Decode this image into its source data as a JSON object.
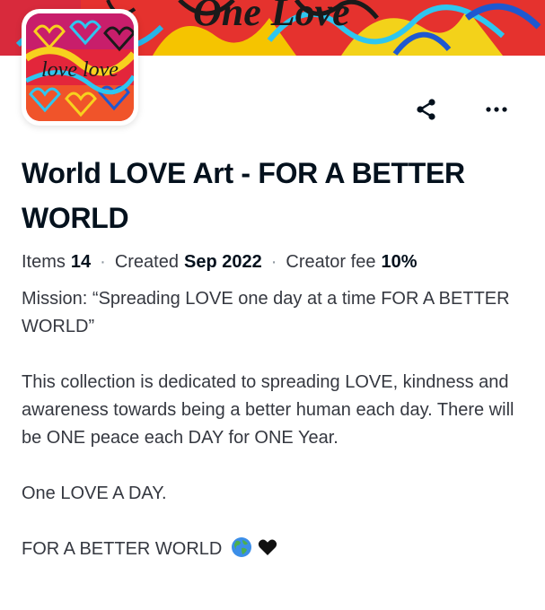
{
  "banner": {
    "art_text": "One Love"
  },
  "avatar": {
    "art_text": "love love"
  },
  "actions": {
    "share_icon": "share-icon",
    "more_icon": "more-icon"
  },
  "collection": {
    "title": "World LOVE Art - FOR A BETTER WORLD",
    "stats": {
      "items_label": "Items",
      "items_value": "14",
      "created_label": "Created",
      "created_value": "Sep 2022",
      "fee_label": "Creator fee",
      "fee_value": "10%",
      "separator": "·"
    },
    "description": {
      "mission": "Mission: “Spreading LOVE one day at a time FOR A BETTER WORLD”",
      "body": "This collection is dedicated to spreading LOVE, kindness and awareness towards being a better human each day. There will be ONE peace each DAY for ONE Year.",
      "tagline": "One LOVE A DAY.",
      "closing": "FOR A BETTER WORLD"
    },
    "closing_icons": [
      "globe-emoji",
      "black-heart-emoji"
    ]
  }
}
